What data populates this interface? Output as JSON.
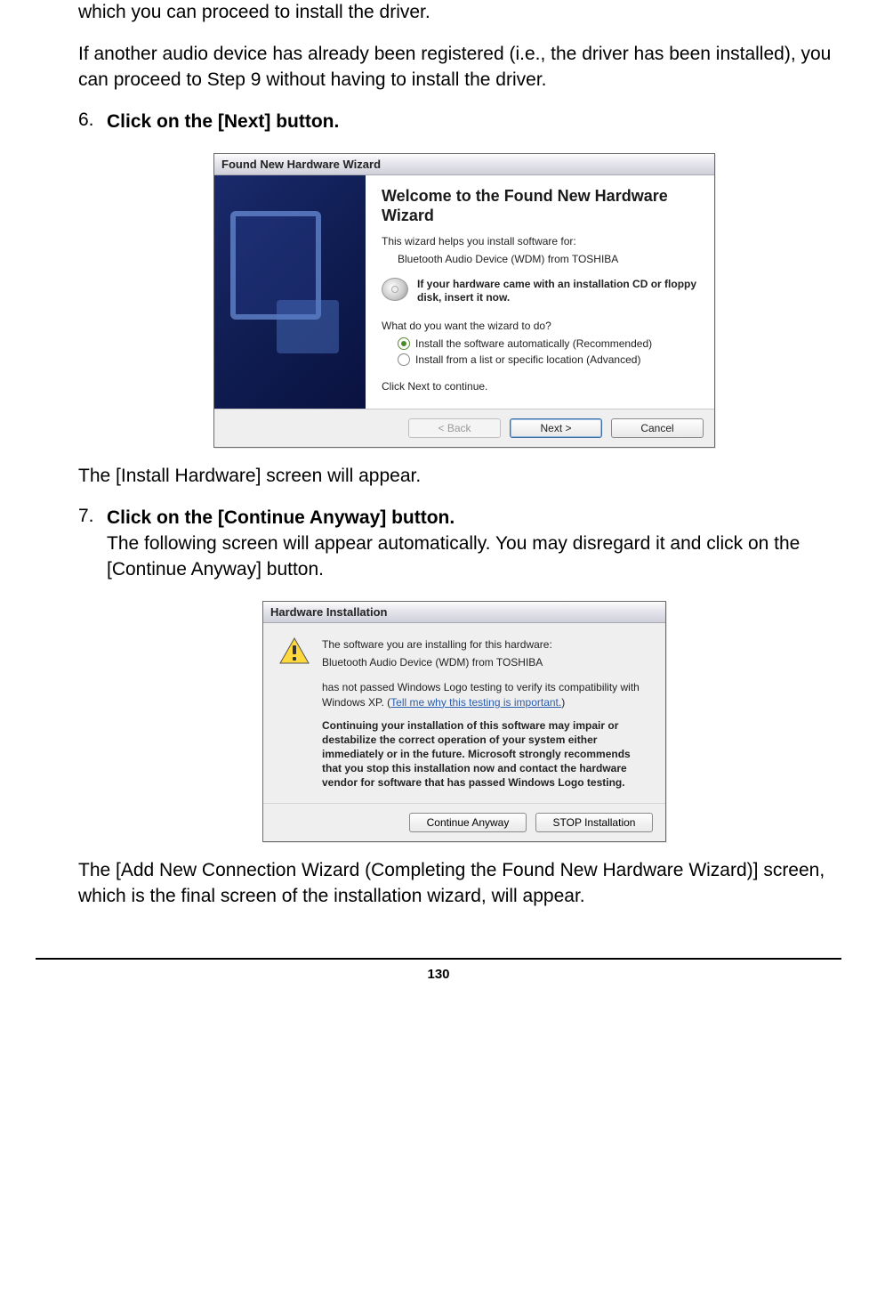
{
  "intro": {
    "line1": "which you can proceed to install the driver.",
    "line2": "If another audio device has already been registered (i.e., the driver has been installed), you can proceed to Step 9 without having to install the driver."
  },
  "step6": {
    "num": "6.",
    "title": "Click on the [Next] button."
  },
  "dialog1": {
    "title": "Found New Hardware Wizard",
    "heading": "Welcome to the Found New Hardware Wizard",
    "helps": "This wizard helps you install software for:",
    "device": "Bluetooth Audio Device (WDM) from TOSHIBA",
    "cd_hint": "If your hardware came with an installation CD or floppy disk, insert it now.",
    "question": "What do you want the wizard to do?",
    "opt1": "Install the software automatically (Recommended)",
    "opt2": "Install from a list or specific location (Advanced)",
    "click_next": "Click Next to continue.",
    "back": "< Back",
    "next": "Next >",
    "cancel": "Cancel"
  },
  "after1": "The [Install Hardware] screen will appear.",
  "step7": {
    "num": "7.",
    "title": "Click on the [Continue Anyway] button.",
    "body": "The following screen will appear automatically. You may disregard it and click on the [Continue Anyway] button."
  },
  "dialog2": {
    "title": "Hardware Installation",
    "p1": "The software you are installing for this hardware:",
    "device": "Bluetooth Audio Device (WDM) from TOSHIBA",
    "p2a": "has not passed Windows Logo testing to verify its compatibility with Windows XP. (",
    "p2link": "Tell me why this testing is important.",
    "p2b": ")",
    "bold": "Continuing your installation of this software may impair or destabilize the correct operation of your system either immediately or in the future. Microsoft strongly recommends that you stop this installation now and contact the hardware vendor for software that has passed Windows Logo testing.",
    "continue": "Continue Anyway",
    "stop": "STOP Installation"
  },
  "after2": "The [Add New Connection Wizard (Completing the Found New Hardware Wizard)] screen, which is the final screen of the installation wizard, will appear.",
  "page_number": "130"
}
